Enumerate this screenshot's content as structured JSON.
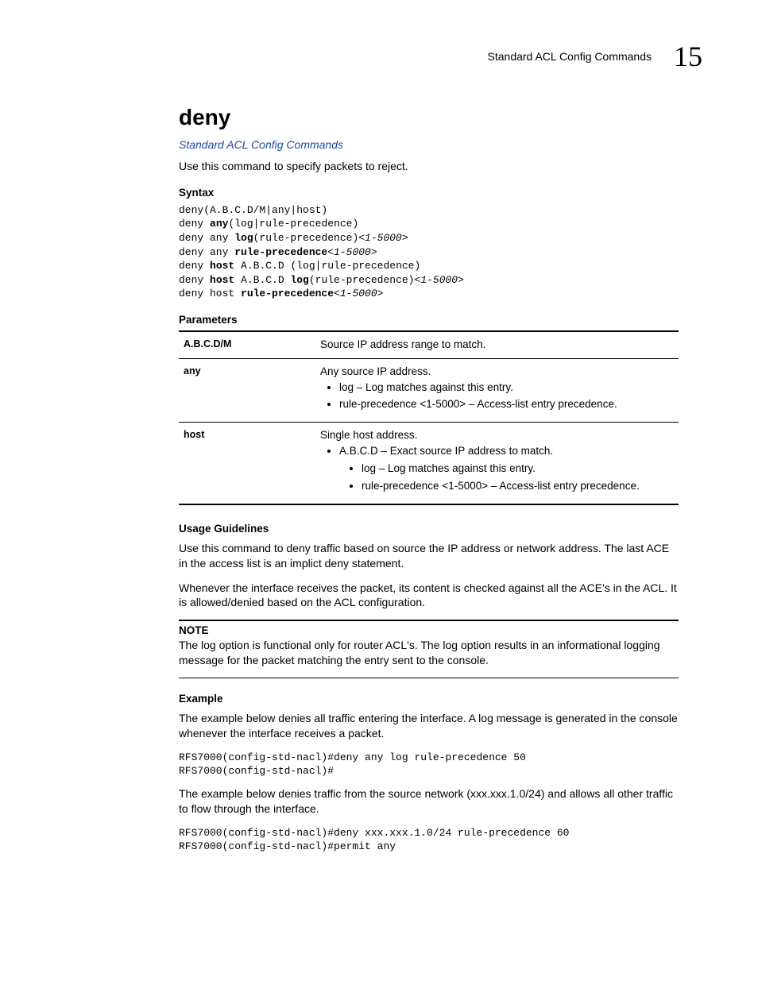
{
  "header": {
    "section": "Standard ACL Config Commands",
    "chapter_number": "15"
  },
  "title": "deny",
  "xref": "Standard ACL Config Commands",
  "intro": "Use this command to specify packets to reject.",
  "sections": {
    "syntax": "Syntax",
    "parameters": "Parameters",
    "usage": "Usage Guidelines",
    "note": "NOTE",
    "example": "Example"
  },
  "syntax_lines": {
    "l1": "deny(A.B.C.D/M|any|host)",
    "l2a": "deny ",
    "l2b": "any",
    "l2c": "(log|rule-precedence)",
    "l3a": "deny any ",
    "l3b": "log",
    "l3c": "(rule-precedence)",
    "l3d": "<1-5000>",
    "l4a": "deny any ",
    "l4b": "rule-precedence",
    "l4c": "<1-5000>",
    "l5a": "deny ",
    "l5b": "host",
    "l5c": " A.B.C.D (log|rule-precedence)",
    "l6a": "deny ",
    "l6b": "host",
    "l6c": " A.B.C.D ",
    "l6d": "log",
    "l6e": "(rule-precedence)",
    "l6f": "<1-5000>",
    "l7a": "deny host ",
    "l7b": "rule-precedence",
    "l7c": "<1-5000>"
  },
  "params": {
    "row1_key": "A.B.C.D/M",
    "row1_desc": "Source IP address range to match.",
    "row2_key": "any",
    "row2_desc": "Any source IP address.",
    "row2_b1": "log – Log matches against this entry.",
    "row2_b2": "rule-precedence <1-5000> – Access-list entry precedence.",
    "row3_key": "host",
    "row3_desc": "Single host address.",
    "row3_b1": "A.B.C.D – Exact source IP address to match.",
    "row3_b1a": "log – Log matches against this entry.",
    "row3_b1b": "rule-precedence <1-5000> – Access-list entry precedence."
  },
  "usage": {
    "p1": "Use this command to deny traffic based on source the IP address or network address. The last ACE in the access list is an implict deny statement.",
    "p2": "Whenever the interface receives the packet, its content is checked against all the ACE's in the ACL. It is allowed/denied based on the ACL configuration."
  },
  "note": "The log option is functional only for router ACL's. The log option results in an informational logging message for the packet matching the entry sent to the console.",
  "example": {
    "p1": "The example below denies all traffic entering the interface. A log message is generated in the console whenever the interface receives a packet.",
    "c1": "RFS7000(config-std-nacl)#deny any log rule-precedence 50\nRFS7000(config-std-nacl)#",
    "p2": "The example below denies traffic from the source network (xxx.xxx.1.0/24) and allows all other traffic to flow through the interface.",
    "c2": "RFS7000(config-std-nacl)#deny xxx.xxx.1.0/24 rule-precedence 60\nRFS7000(config-std-nacl)#permit any"
  }
}
